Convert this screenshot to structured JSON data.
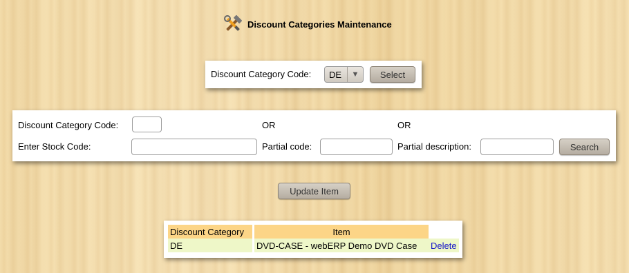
{
  "page": {
    "title": "Discount Categories Maintenance",
    "icon": "tools-icon"
  },
  "select_form": {
    "label": "Discount Category Code:",
    "selected_value": "DE",
    "select_button": "Select"
  },
  "search_form": {
    "category_label": "Discount Category Code:",
    "category_value": "",
    "or_1": "OR",
    "or_2": "OR",
    "stock_label": "Enter Stock Code:",
    "stock_value": "",
    "partial_code_label": "Partial code:",
    "partial_code_value": "",
    "partial_desc_label": "Partial description:",
    "partial_desc_value": "",
    "search_button": "Search"
  },
  "update_button": "Update Item",
  "results_table": {
    "columns": [
      "Discount Category",
      "Item"
    ],
    "rows": [
      {
        "category": "DE",
        "item": "DVD-CASE - webERP Demo DVD Case",
        "action": "Delete"
      }
    ]
  },
  "colors": {
    "table_header": "#fcd587",
    "table_row": "#eef7c8",
    "link": "#1515c8"
  }
}
